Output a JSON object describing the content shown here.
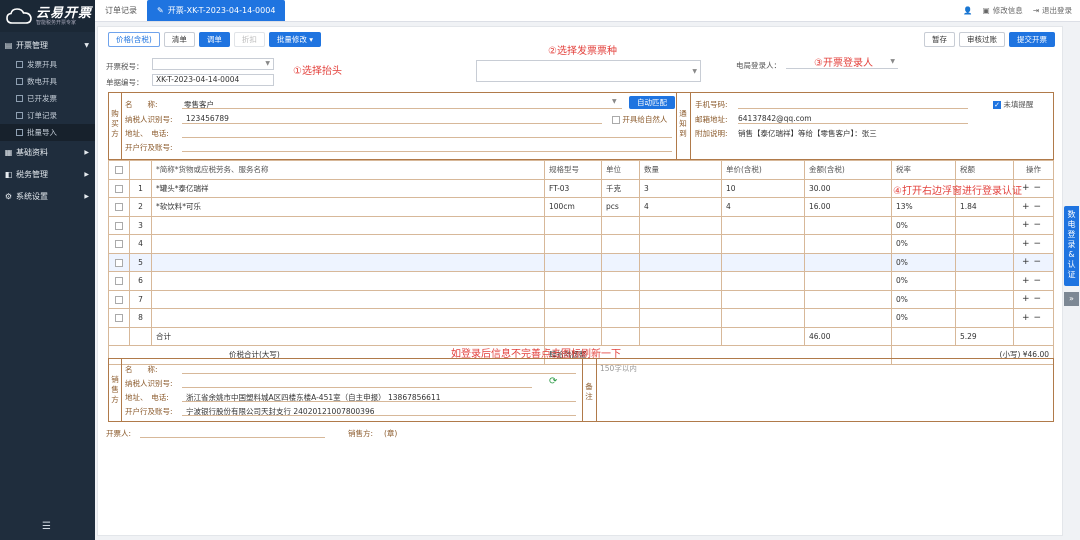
{
  "sidebar": {
    "brand": "云易开票",
    "brand_sub": "智能税务开票专家",
    "groups": [
      {
        "label": "开票管理",
        "icon": "invoice-icon"
      },
      {
        "label": "基础资料",
        "icon": "data-icon"
      },
      {
        "label": "税务管理",
        "icon": "tax-icon"
      },
      {
        "label": "系统设置",
        "icon": "settings-icon"
      }
    ],
    "subs": [
      "发票开具",
      "数电开具",
      "已开发票",
      "订单记录",
      "批量导入"
    ]
  },
  "topbar": {
    "tabs": [
      "订单记录",
      "开票-XK-T-2023-04-14-0004"
    ],
    "modify": "修改信息",
    "logout": "退出登录"
  },
  "toolbar": {
    "price_incl": "价格(含税)",
    "list": "清单",
    "adjust": "调单",
    "discount": "折扣",
    "batch_modify": "批量修改",
    "save_draft": "暂存",
    "review": "审核过账",
    "submit": "提交开票"
  },
  "header": {
    "tax_no_label": "开票税号：",
    "doc_no_label": "单据编号：",
    "doc_no": "XK-T-2023-04-14-0004",
    "e_login_label": "电局登录人："
  },
  "annotations": {
    "a1": "①选择抬头",
    "a2": "②选择发票票种",
    "a3": "③开票登录人",
    "a4": "④打开右边浮窗进行登录认证",
    "a5": "如登录后信息不完善点击图标刷新一下"
  },
  "buyer": {
    "side_label": "购买方",
    "name_label": "名　　称:",
    "name": "零售客户",
    "auto_match": "自动匹配",
    "taxid_label": "纳税人识别号:",
    "taxid": "123456789",
    "natural_person": "开具给自然人",
    "addr_label": "地址、　电话:",
    "bank_label": "开户行及账号:",
    "notify_side": "通知到",
    "phone_label": "手机号码:",
    "email_label": "邮箱地址:",
    "email": "64137842@qq.com",
    "note_label": "附加说明:",
    "note": "销售【泰亿瑞祥】等给【零售客户】：张三",
    "unfilled_remind": "未填提醒"
  },
  "items": {
    "headers": [
      "",
      "",
      "*简称*货物或应税劳务、服务名称",
      "规格型号",
      "单位",
      "数量",
      "单价(含税)",
      "金额(含税)",
      "税率",
      "税额",
      "操作"
    ],
    "rows": [
      {
        "no": "1",
        "name": "*罐头*泰亿瑞祥",
        "spec": "FT-03",
        "unit": "千克",
        "qty": "3",
        "price": "10",
        "amount": "30.00",
        "rate": "",
        "tax": ""
      },
      {
        "no": "2",
        "name": "*软饮料*可乐",
        "spec": "100cm",
        "unit": "pcs",
        "qty": "4",
        "price": "4",
        "amount": "16.00",
        "rate": "13%",
        "tax": "1.84"
      },
      {
        "no": "3",
        "name": "",
        "spec": "",
        "unit": "",
        "qty": "",
        "price": "",
        "amount": "",
        "rate": "0%",
        "tax": ""
      },
      {
        "no": "4",
        "name": "",
        "spec": "",
        "unit": "",
        "qty": "",
        "price": "",
        "amount": "",
        "rate": "0%",
        "tax": ""
      },
      {
        "no": "5",
        "name": "",
        "spec": "",
        "unit": "",
        "qty": "",
        "price": "",
        "amount": "",
        "rate": "0%",
        "tax": ""
      },
      {
        "no": "6",
        "name": "",
        "spec": "",
        "unit": "",
        "qty": "",
        "price": "",
        "amount": "",
        "rate": "0%",
        "tax": ""
      },
      {
        "no": "7",
        "name": "",
        "spec": "",
        "unit": "",
        "qty": "",
        "price": "",
        "amount": "",
        "rate": "0%",
        "tax": ""
      },
      {
        "no": "8",
        "name": "",
        "spec": "",
        "unit": "",
        "qty": "",
        "price": "",
        "amount": "",
        "rate": "0%",
        "tax": ""
      }
    ],
    "total_label": "合计",
    "total_amount": "46.00",
    "total_tax": "5.29",
    "grand_label": "价税合计(大写)",
    "grand_words": "肆拾陆圆整",
    "grand_small": "(小写) ¥46.00"
  },
  "seller": {
    "side_label": "销售方",
    "name_label": "名　　称:",
    "taxid_label": "纳税人识别号:",
    "addr_label": "地址、　电话:",
    "addr": "浙江省余姚市中国塑料城A区四楼东楼A-451室（自主申报） 13867856611",
    "bank_label": "开户行及账号:",
    "bank": "宁波银行股份有限公司天封支行 24020121007800396",
    "remark_label": "备注",
    "remark_placeholder": "150字以内"
  },
  "footer": {
    "issuer_label": "开票人:",
    "seller_label": "销售方:",
    "seal": "(章)"
  },
  "float": {
    "login_label": "数电登录&认证",
    "arrow": "»"
  },
  "colors": {
    "accent": "#1f74e0",
    "annotation": "#e3413c",
    "invoice_border": "#b07a4a"
  }
}
